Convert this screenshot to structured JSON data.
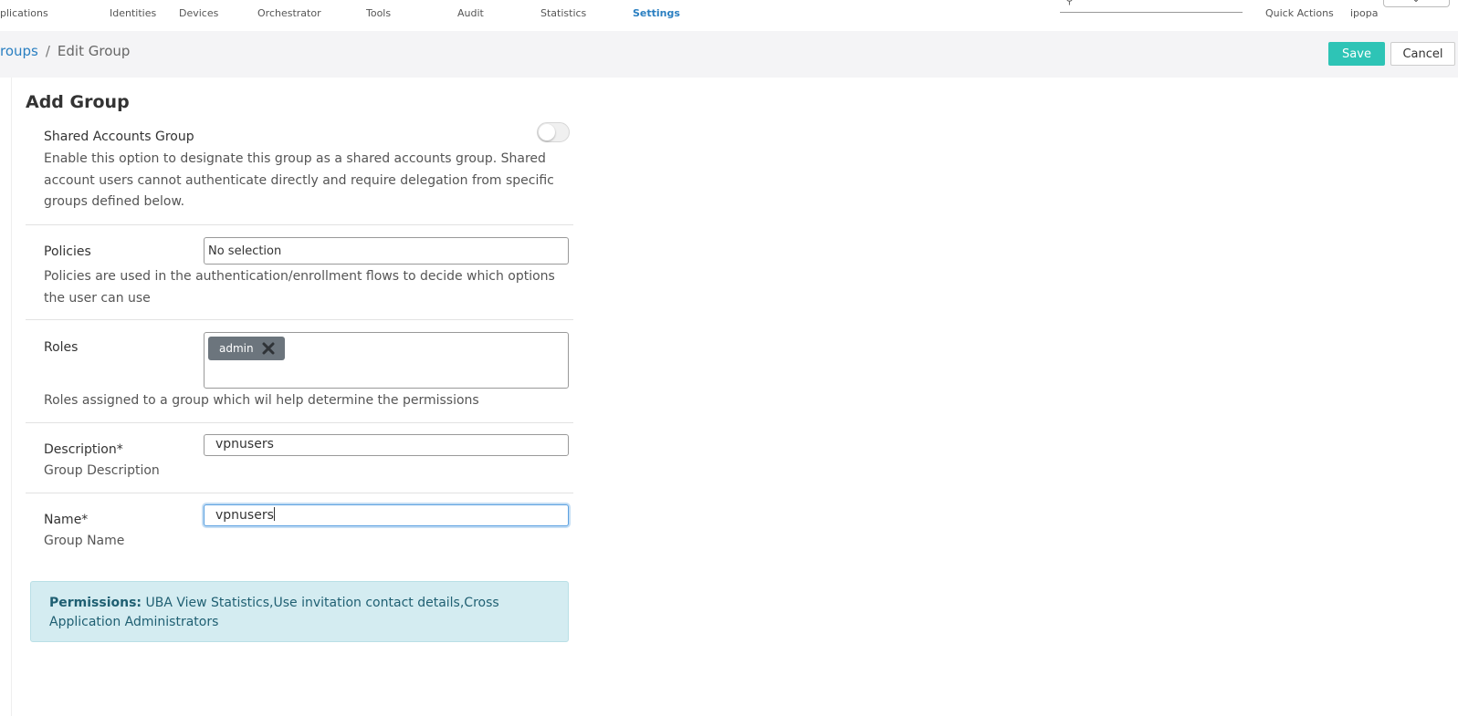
{
  "nav": {
    "items": [
      {
        "label": "plications",
        "active": false
      },
      {
        "label": "Identities",
        "active": false
      },
      {
        "label": "Devices",
        "active": false
      },
      {
        "label": "Orchestrator",
        "active": false
      },
      {
        "label": "Tools",
        "active": false
      },
      {
        "label": "Audit",
        "active": false
      },
      {
        "label": "Statistics",
        "active": false
      },
      {
        "label": "Settings",
        "active": true
      }
    ],
    "quick_actions": "Quick Actions",
    "user": "ipopa"
  },
  "breadcrumb": {
    "parent": "roups",
    "separator": "/",
    "current": "Edit Group"
  },
  "toolbar": {
    "save_label": "Save",
    "cancel_label": "Cancel"
  },
  "form": {
    "title": "Add Group",
    "shared": {
      "label": "Shared Accounts Group",
      "help": "Enable this option to designate this group as a shared accounts group. Shared account users cannot authenticate directly and require delegation from specific groups defined below.",
      "enabled": false
    },
    "policies": {
      "label": "Policies",
      "value": "No selection",
      "help": "Policies are used in the authentication/enrollment flows to decide which options the user can use"
    },
    "roles": {
      "label": "Roles",
      "chips": [
        "admin"
      ],
      "help": "Roles assigned to a group which wil help determine the permissions"
    },
    "description": {
      "label": "Description*",
      "sublabel": "Group Description",
      "value": "vpnusers"
    },
    "name": {
      "label": "Name*",
      "sublabel": "Group Name",
      "value": "vpnusers"
    }
  },
  "permissions": {
    "label": "Permissions:",
    "value": "UBA View Statistics,Use invitation contact details,Cross Application Administrators"
  },
  "colors": {
    "accent": "#2a7fc1",
    "save": "#2ec4b6",
    "info_bg": "#d4ecf1",
    "chip": "#6c757d"
  }
}
